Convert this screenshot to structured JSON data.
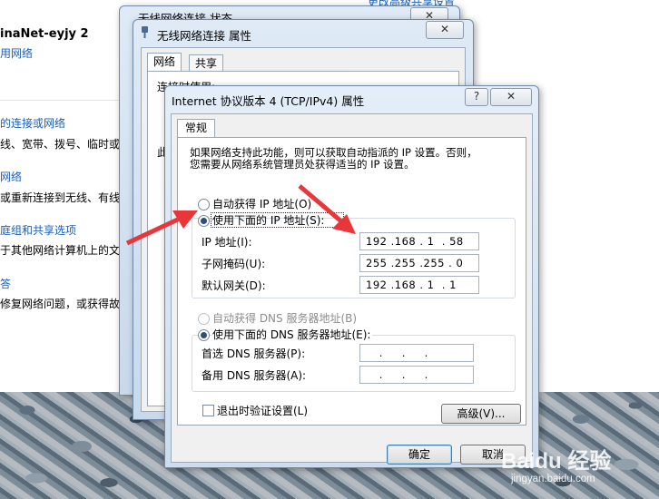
{
  "control_panel": {
    "network_name": "inaNet-eyjy  2",
    "network_type": "用网络",
    "top_link": "更改高级共享设置",
    "items": [
      {
        "text": "的连接或网络",
        "link": true
      },
      {
        "text": "线、宽带、拨号、临时或",
        "link": false
      },
      {
        "text": "网络",
        "link": true
      },
      {
        "text": "或重新连接到无线、有线",
        "link": false
      },
      {
        "text": "庭组和共享选项",
        "link": true
      },
      {
        "text": "于其他网络计算机上的文",
        "link": false
      },
      {
        "text": "答",
        "link": true
      },
      {
        "text": "修复网络问题，或获得故",
        "link": false
      }
    ]
  },
  "status_window": {
    "title": "无线网络连接 状态",
    "close": "✕"
  },
  "props_window": {
    "title": "无线网络连接 属性",
    "close": "✕",
    "tabs": [
      "网络",
      "共享"
    ],
    "connect_using": "连接时使用:",
    "this_conn": "此"
  },
  "ipv4_dialog": {
    "title": "Internet 协议版本 4 (TCP/IPv4) 属性",
    "help": "?",
    "close": "✕",
    "tab": "常规",
    "description": [
      "如果网络支持此功能，则可以获取自动指派的 IP 设置。否则，",
      "您需要从网络系统管理员处获得适当的 IP 设置。"
    ],
    "auto_ip_label": "自动获得 IP 地址(O)",
    "use_ip_label": "使用下面的 IP 地址(S):",
    "ip_label": "IP 地址(I):",
    "ip_value": "192 .168 . 1  . 58",
    "mask_label": "子网掩码(U):",
    "mask_value": "255 .255 .255 . 0",
    "gateway_label": "默认网关(D):",
    "gateway_value": "192 .168 . 1  . 1",
    "auto_dns_label": "自动获得 DNS 服务器地址(B)",
    "use_dns_label": "使用下面的 DNS 服务器地址(E):",
    "pref_dns_label": "首选 DNS 服务器(P):",
    "pref_dns_value": "     .     .     .",
    "alt_dns_label": "备用 DNS 服务器(A):",
    "alt_dns_value": "     .     .     .",
    "validate_label": "退出时验证设置(L)",
    "advanced": "高级(V)...",
    "ok": "确定",
    "cancel": "取消",
    "ip_mode": "manual",
    "dns_mode": "manual",
    "validate_checked": false
  },
  "watermark": {
    "brand": "Baidu 经验",
    "url": "jingyan.baidu.com"
  },
  "colors": {
    "arrow": "#e8373a",
    "link": "#1e5fb4",
    "window_frame": "#6f8aa8"
  }
}
